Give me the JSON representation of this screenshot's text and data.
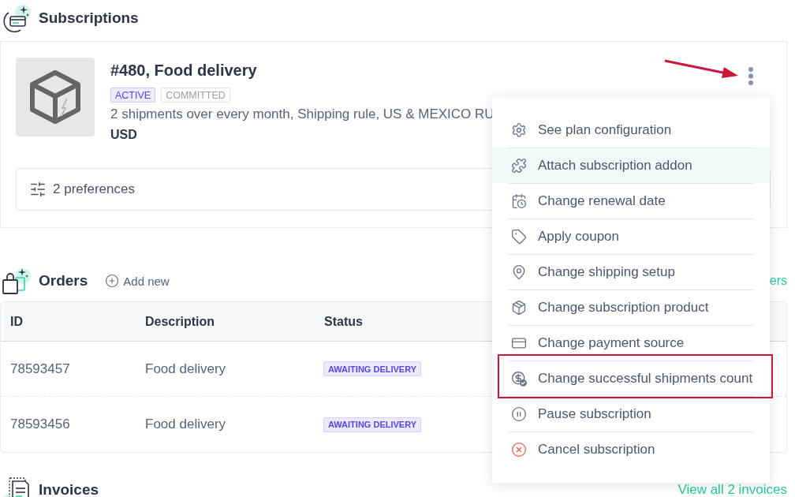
{
  "subscriptions": {
    "title": "Subscriptions",
    "card": {
      "title": "#480, Food delivery",
      "badges": [
        {
          "label": "ACTIVE",
          "kind": "primary"
        },
        {
          "label": "COMMITTED",
          "kind": "muted"
        }
      ],
      "description": "2 shipments over every month, Shipping rule, US & MEXICO RU",
      "currency": "USD",
      "preferences": "2 preferences",
      "menu_button": {
        "pointed_at": true
      },
      "menu": {
        "open": true,
        "items": [
          {
            "label": "See plan configuration",
            "kind": "normal",
            "hovered": false,
            "annotated": false
          },
          {
            "label": "Attach subscription addon",
            "kind": "normal",
            "hovered": true,
            "annotated": false
          },
          {
            "label": "Change renewal date",
            "kind": "normal",
            "hovered": false,
            "annotated": false
          },
          {
            "label": "Apply coupon",
            "kind": "normal",
            "hovered": false,
            "annotated": false
          },
          {
            "label": "Change shipping setup",
            "kind": "normal",
            "hovered": false,
            "annotated": false
          },
          {
            "label": "Change subscription product",
            "kind": "normal",
            "hovered": false,
            "annotated": false
          },
          {
            "label": "Change payment source",
            "kind": "normal",
            "hovered": false,
            "annotated": false
          },
          {
            "label": "Change successful shipments count",
            "kind": "normal",
            "hovered": false,
            "annotated": true
          },
          {
            "label": "Pause subscription",
            "kind": "normal",
            "hovered": false,
            "annotated": false
          },
          {
            "label": "Cancel subscription",
            "kind": "danger",
            "hovered": false,
            "annotated": false
          }
        ]
      }
    }
  },
  "orders": {
    "title": "Orders",
    "add_button": "Add new",
    "view_all_link": "ers",
    "table": {
      "columns": [
        "ID",
        "Description",
        "Status"
      ],
      "rows": [
        {
          "id": "78593457",
          "description": "Food delivery",
          "status": "AWAITING DELIVERY"
        },
        {
          "id": "78593456",
          "description": "Food delivery",
          "status": "AWAITING DELIVERY"
        }
      ]
    }
  },
  "invoices": {
    "title": "Invoices",
    "view_all_link": "View all 2 invoices"
  }
}
